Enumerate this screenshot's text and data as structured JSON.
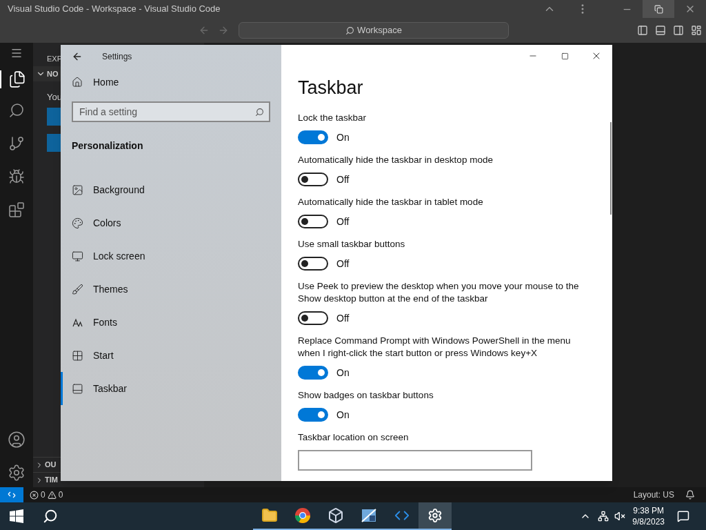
{
  "vscode": {
    "title": "Visual Studio Code - Workspace - Visual Studio Code",
    "command_center": "Workspace",
    "explorer_title": "EXP",
    "section": "NO",
    "message": "You",
    "bottom_sections": [
      "OU",
      "TIM"
    ],
    "errors": "0",
    "warnings": "0",
    "layout": "Layout: US"
  },
  "settings": {
    "title": "Settings",
    "home": "Home",
    "search": {
      "placeholder": "Find a setting"
    },
    "section": "Personalization",
    "nav": [
      {
        "label": "Background",
        "selected": false
      },
      {
        "label": "Colors",
        "selected": false
      },
      {
        "label": "Lock screen",
        "selected": false
      },
      {
        "label": "Themes",
        "selected": false
      },
      {
        "label": "Fonts",
        "selected": false
      },
      {
        "label": "Start",
        "selected": false
      },
      {
        "label": "Taskbar",
        "selected": true
      }
    ],
    "page_title": "Taskbar",
    "options": [
      {
        "kind": "toggle",
        "label": "Lock the taskbar",
        "on": true,
        "state": "On"
      },
      {
        "kind": "toggle",
        "label": "Automatically hide the taskbar in desktop mode",
        "on": false,
        "state": "Off"
      },
      {
        "kind": "toggle",
        "label": "Automatically hide the taskbar in tablet mode",
        "on": false,
        "state": "Off"
      },
      {
        "kind": "toggle",
        "label": "Use small taskbar buttons",
        "on": false,
        "state": "Off"
      },
      {
        "kind": "toggle",
        "label": "Use Peek to preview the desktop when you move your mouse to the Show desktop button at the end of the taskbar",
        "on": false,
        "state": "Off"
      },
      {
        "kind": "toggle",
        "label": "Replace Command Prompt with Windows PowerShell in the menu when I right-click the start button or press Windows key+X",
        "on": true,
        "state": "On"
      },
      {
        "kind": "toggle",
        "label": "Show badges on taskbar buttons",
        "on": true,
        "state": "On"
      },
      {
        "kind": "dropdown",
        "label": "Taskbar location on screen"
      }
    ]
  },
  "taskbar": {
    "apps": [
      {
        "selected": false
      },
      {
        "selected": false
      },
      {
        "selected": false
      },
      {
        "selected": false
      },
      {
        "selected": false
      },
      {
        "selected": true
      }
    ],
    "time": "9:38 PM",
    "date": "9/8/2023"
  }
}
